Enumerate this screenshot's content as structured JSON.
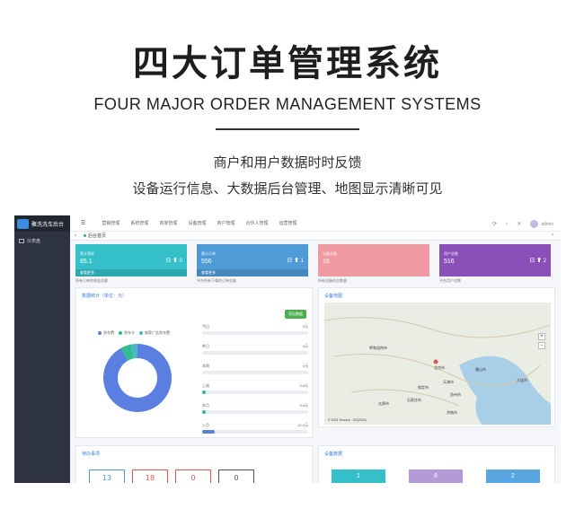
{
  "hero": {
    "title": "四大订单管理系统",
    "subtitle": "FOUR MAJOR ORDER MANAGEMENT SYSTEMS",
    "desc_line1": "商户和用户数据时时反馈",
    "desc_line2": "设备运行信息、大数据后台管理、地图显示清晰可见"
  },
  "app": {
    "brand": "聚洗洗车后台",
    "sidebar": {
      "items": [
        {
          "label": "仪表盘"
        }
      ]
    },
    "topbar": {
      "menu_toggle": "☰",
      "nav": [
        "营销管理",
        "系统管理",
        "商家管理",
        "设备管理",
        "商户管理",
        "合伙人管理",
        "运营管理"
      ],
      "icons": [
        "refresh-icon",
        "fullscreen-icon",
        "expand-icon"
      ],
      "user": "admin"
    },
    "tabs": {
      "active": "后台首页",
      "left_arrow": "‹",
      "right_arrow": "›"
    },
    "cards": [
      {
        "label": "累计营收",
        "value": "85.1",
        "badge": "日 ⬆ 0",
        "footer": "查看更多",
        "note": "所有订单的收益总额",
        "color": "#35c0c9"
      },
      {
        "label": "累计订单",
        "value": "556",
        "badge": "日 ⬆ 1",
        "footer": "查看更多",
        "note": "平台所有下载的订单总量",
        "color": "#4e9bd8"
      },
      {
        "label": "设备总数",
        "value": "16",
        "badge": "",
        "footer": "",
        "note": "所有设备的总数量",
        "color": "#ef9aa3"
      },
      {
        "label": "用户总数",
        "value": "516",
        "badge": "日 ⬆ 2",
        "footer": "",
        "note": "平台用户总数",
        "color": "#8b50b8"
      }
    ],
    "stats_panel": {
      "title": "数据统计（单位：元）",
      "export_label": "导出数据",
      "legend": [
        {
          "name": "洗车费",
          "color": "#5b7fe0"
        },
        {
          "name": "洗车卡",
          "color": "#2fbe8f"
        },
        {
          "name": "商家广告洗车费",
          "color": "#4fb6c9"
        }
      ],
      "donut": [
        {
          "name": "洗车费",
          "value": 92,
          "color": "#5b7fe0"
        },
        {
          "name": "洗车卡",
          "value": 5,
          "color": "#2fbe8f"
        },
        {
          "name": "商家广告洗车费",
          "value": 3,
          "color": "#4fb6c9"
        }
      ],
      "rows": [
        {
          "label": "今日",
          "value": "0元",
          "fraction": 0.0,
          "color": "#2fbe8f"
        },
        {
          "label": "昨日",
          "value": "0元",
          "fraction": 0.0,
          "color": "#2fbe8f"
        },
        {
          "label": "本周",
          "value": "0元",
          "fraction": 0.0,
          "color": "#2fbe8f"
        },
        {
          "label": "上周",
          "value": "3.6元",
          "fraction": 0.03,
          "color": "#2fbe8f"
        },
        {
          "label": "本月",
          "value": "3.6元",
          "fraction": 0.03,
          "color": "#2fbe8f"
        },
        {
          "label": "上月",
          "value": "12.4元",
          "fraction": 0.12,
          "color": "#5b7fe0"
        }
      ]
    },
    "map_panel": {
      "title": "设备地图",
      "labels": [
        "呼和浩特市",
        "北京市",
        "天津市",
        "唐山市",
        "保定市",
        "石家庄市",
        "太原市",
        "济南市",
        "大连市",
        "沧州市"
      ],
      "zoom_in": "+",
      "zoom_out": "−",
      "credit": "© 2023 Tencent - GS(2023)"
    },
    "todo_panel": {
      "title": "待办事项",
      "items": [
        {
          "value": "13",
          "color": "#4e9bd8"
        },
        {
          "value": "18",
          "color": "#e0554f"
        },
        {
          "value": "0",
          "color": "#e0554f"
        },
        {
          "value": "0",
          "color": "#555555"
        }
      ]
    },
    "device_panel": {
      "title": "设备数据",
      "items": [
        {
          "value": "1",
          "color": "#35c0c9"
        },
        {
          "value": "8",
          "color": "#b69ad8"
        },
        {
          "value": "2",
          "color": "#5aa6e0"
        }
      ]
    }
  }
}
